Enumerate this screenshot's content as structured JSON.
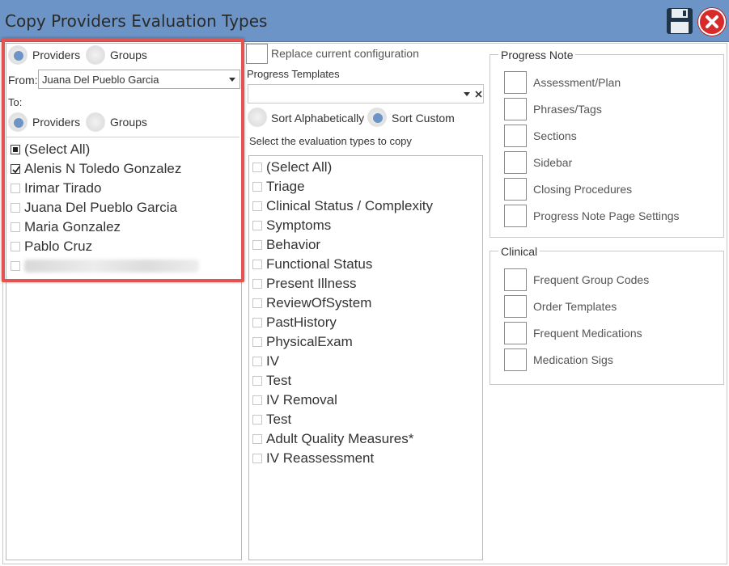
{
  "window": {
    "title": "Copy Providers Evaluation Types"
  },
  "icons": {
    "save": "floppy-disk-icon",
    "close": "close-x-icon"
  },
  "left": {
    "source_type": {
      "providers": "Providers",
      "groups": "Groups",
      "selected": "Providers"
    },
    "from_label": "From:",
    "from_value": "Juana Del Pueblo Garcia",
    "to_label": "To:",
    "target_type": {
      "providers": "Providers",
      "groups": "Groups",
      "selected": "Providers"
    },
    "list": [
      {
        "label": "(Select All)",
        "state": "indeterminate"
      },
      {
        "label": "Alenis N Toledo Gonzalez",
        "state": "checked"
      },
      {
        "label": "Irimar Tirado",
        "state": "unchecked"
      },
      {
        "label": "Juana Del Pueblo Garcia",
        "state": "unchecked"
      },
      {
        "label": "Maria Gonzalez",
        "state": "unchecked"
      },
      {
        "label": "Pablo Cruz",
        "state": "unchecked"
      }
    ]
  },
  "middle": {
    "replace_label": "Replace current configuration",
    "progress_templates_label": "Progress Templates",
    "combo_value": "",
    "sort_alpha": "Sort Alphabetically",
    "sort_custom": "Sort Custom",
    "sort_selected": "Sort Custom",
    "select_label": "Select the evaluation types to copy",
    "eval_types": [
      "(Select All)",
      "Triage",
      "Clinical Status / Complexity",
      "Symptoms",
      "Behavior",
      "Functional Status",
      "Present Illness",
      "ReviewOfSystem",
      "PastHistory",
      "PhysicalExam",
      "IV",
      "Test",
      "IV Removal",
      "Test",
      "Adult Quality Measures*",
      "IV Reassessment"
    ]
  },
  "right": {
    "progress_note": {
      "title": "Progress Note",
      "items": [
        "Assessment/Plan",
        "Phrases/Tags",
        "Sections",
        "Sidebar",
        "Closing Procedures",
        "Progress Note Page Settings"
      ]
    },
    "clinical": {
      "title": "Clinical",
      "items": [
        "Frequent Group Codes",
        "Order Templates",
        "Frequent Medications",
        "Medication Sigs"
      ]
    }
  },
  "colors": {
    "titlebar": "#6c94c6",
    "highlight": "#e35451",
    "radio_on": "#6c94c6",
    "close": "#d72b2b"
  }
}
